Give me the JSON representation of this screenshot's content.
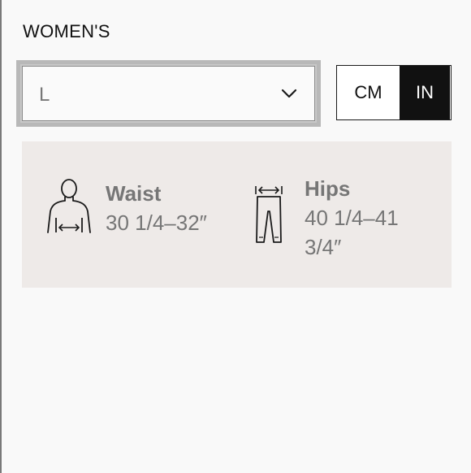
{
  "section": {
    "title": "WOMEN'S"
  },
  "size_select": {
    "selected": "L"
  },
  "units": {
    "options": [
      "CM",
      "IN"
    ],
    "active": "IN"
  },
  "measurements": [
    {
      "label": "Waist",
      "value": "30 1/4–32″",
      "icon": "torso-waist-icon"
    },
    {
      "label": "Hips",
      "value": "40 1/4–41 3/4″",
      "icon": "trousers-hips-icon"
    }
  ],
  "colors": {
    "panel_bg": "#eeeae8",
    "active_unit_bg": "#111111",
    "muted_text": "#767676"
  }
}
